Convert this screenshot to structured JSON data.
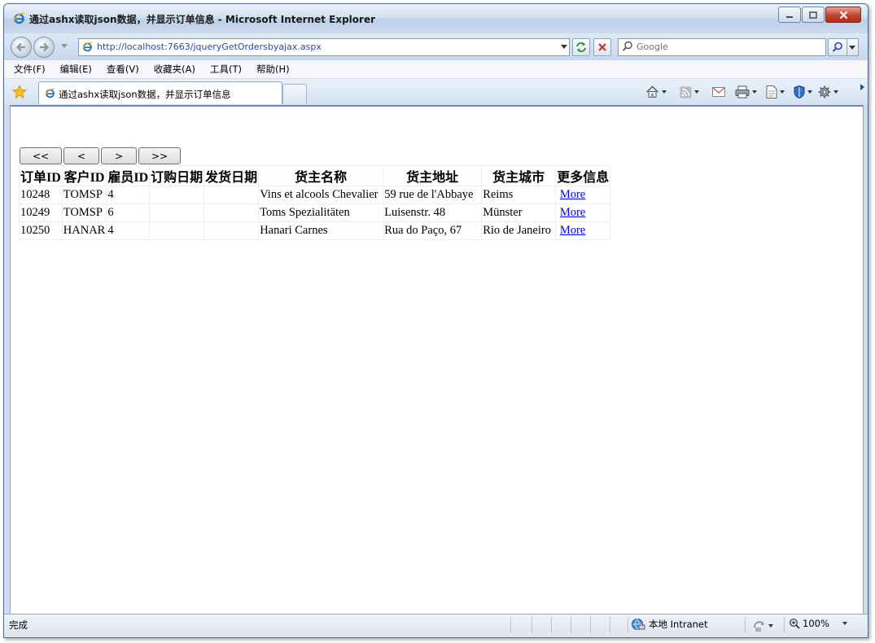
{
  "window": {
    "title": "通过ashx读取json数据，并显示订单信息 - Microsoft Internet Explorer"
  },
  "address": {
    "url": "http://localhost:7663/jqueryGetOrdersbyajax.aspx"
  },
  "search": {
    "placeholder": "Google"
  },
  "menu": {
    "items": [
      {
        "label": "文件(F)"
      },
      {
        "label": "编辑(E)"
      },
      {
        "label": "查看(V)"
      },
      {
        "label": "收藏夹(A)"
      },
      {
        "label": "工具(T)"
      },
      {
        "label": "帮助(H)"
      }
    ]
  },
  "tabs": [
    {
      "label": "通过ashx读取json数据，并显示订单信息"
    }
  ],
  "pager": {
    "first": "<<",
    "prev": "<",
    "next": ">",
    "last": ">>"
  },
  "table": {
    "headers": [
      "订单ID",
      "客户ID",
      "雇员ID",
      "订购日期",
      "发货日期",
      "货主名称",
      "货主地址",
      "货主城市",
      "更多信息"
    ],
    "rows": [
      {
        "order_id": "10248",
        "customer_id": "TOMSP",
        "employee_id": "4",
        "order_date": "",
        "ship_date": "",
        "ship_name": "Vins et alcools Chevalier",
        "ship_address": "59 rue de l'Abbaye",
        "ship_city": "Reims",
        "more": "More"
      },
      {
        "order_id": "10249",
        "customer_id": "TOMSP",
        "employee_id": "6",
        "order_date": "",
        "ship_date": "",
        "ship_name": "Toms Spezialitäten",
        "ship_address": "Luisenstr. 48",
        "ship_city": "Münster",
        "more": "More"
      },
      {
        "order_id": "10250",
        "customer_id": "HANAR",
        "employee_id": "4",
        "order_date": "",
        "ship_date": "",
        "ship_name": "Hanari Carnes",
        "ship_address": "Rua do Paço, 67",
        "ship_city": "Rio de Janeiro",
        "more": "More"
      }
    ]
  },
  "status": {
    "text": "完成",
    "zone": "本地 Intranet",
    "zoom": "100%"
  },
  "colors": {
    "link": "#0000ee",
    "window_border": "#4c6a8e",
    "close_button": "#c2452f"
  }
}
